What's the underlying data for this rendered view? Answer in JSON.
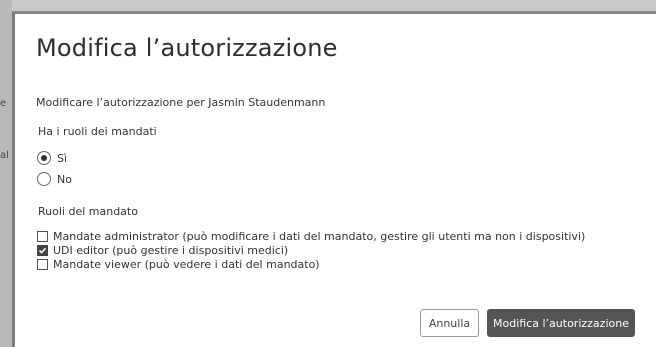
{
  "dialog": {
    "title": "Modifica l’autorizzazione",
    "subtitle": "Modificare l’autorizzazione per Jasmin Staudenmann"
  },
  "background": {
    "fragments": [
      "e",
      "al"
    ]
  },
  "roles_question": {
    "label": "Ha i ruoli dei mandati",
    "options": [
      {
        "label": "Sì",
        "selected": true
      },
      {
        "label": "No",
        "selected": false
      }
    ]
  },
  "mandate_roles": {
    "label": "Ruoli del mandato",
    "items": [
      {
        "label": "Mandate administrator (può modificare i dati del mandato, gestire gli utenti ma non i dispositivi)",
        "checked": false
      },
      {
        "label": "UDI editor (può gestire i dispositivi medici)",
        "checked": true
      },
      {
        "label": "Mandate viewer (può vedere i dati del mandato)",
        "checked": false
      }
    ]
  },
  "buttons": {
    "cancel": "Annulla",
    "submit": "Modifica l’autorizzazione"
  },
  "colors": {
    "primary_button": "#555555",
    "overlay": "#c9c9c9"
  }
}
